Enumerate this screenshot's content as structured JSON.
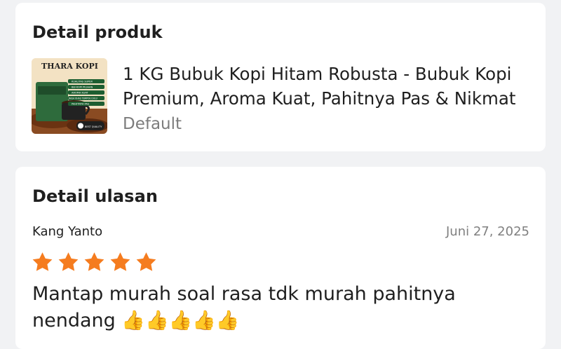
{
  "product_section": {
    "title": "Detail produk",
    "thumbnail": {
      "brand": "THARA KOPI",
      "badges": [
        "KUALITAS SUPER",
        "BIJI KOPI PILIHAN",
        "AROMA KUAT",
        "RASA KHAS TEMPOE DULU",
        "PAHITNYA PAS"
      ],
      "badge_label": "BEST QUALITY"
    },
    "product_name": "1 KG Bubuk Kopi Hitam Robusta - Bubuk Kopi Premium, Aroma Kuat, Pahitnya Pas & Nikmat",
    "variant": "Default"
  },
  "review_section": {
    "title": "Detail ulasan",
    "reviewer": "Kang Yanto",
    "date": "Juni 27, 2025",
    "rating": 5,
    "rating_max": 5,
    "star_color": "#f57c1f",
    "text": "Mantap murah soal rasa tdk murah pahitnya nendang 👍👍👍👍👍"
  }
}
